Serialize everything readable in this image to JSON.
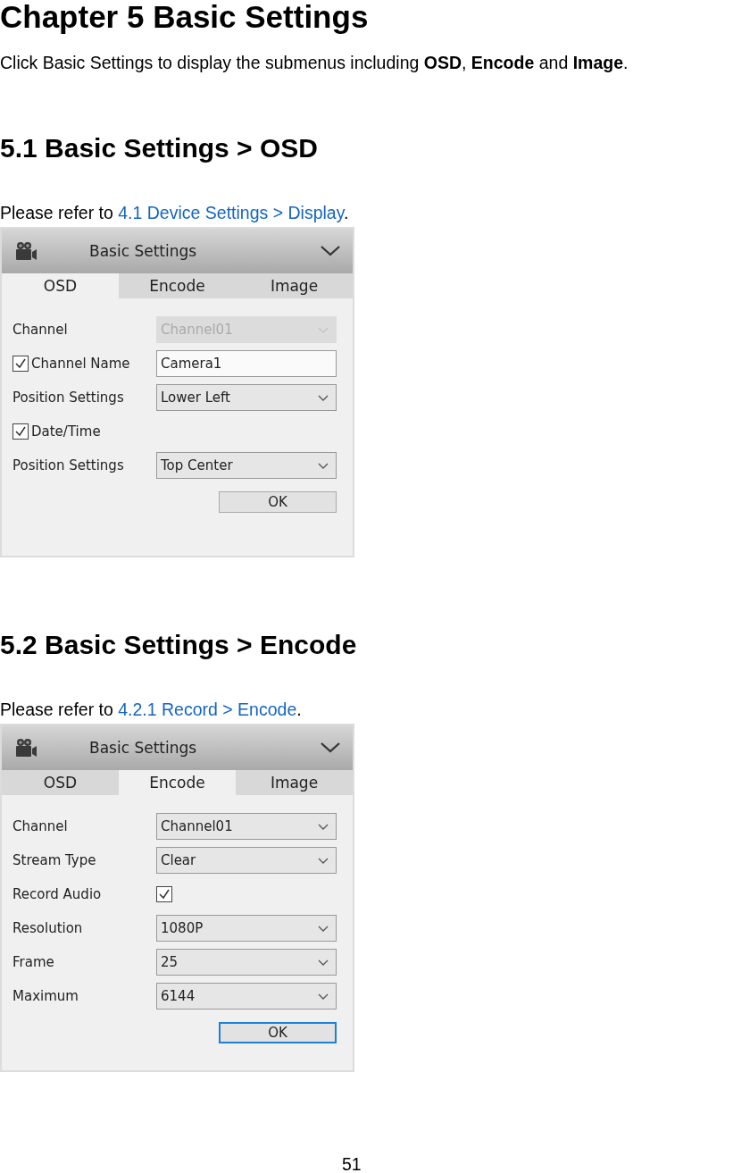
{
  "title": "Chapter 5 Basic Settings",
  "intro": "Click Basic Settings to display the submenus including **OSD**, **Encode** and **Image**.",
  "sections": [
    {
      "heading": "5.1 Basic Settings > OSD",
      "ref_prefix": "Please refer to ",
      "ref_link": "4.1 Device Settings > Display",
      "ref_suffix": ".",
      "panel": {
        "title": "Basic Settings",
        "tabs": [
          {
            "label": "OSD",
            "selected": true
          },
          {
            "label": "Encode",
            "selected": false
          },
          {
            "label": "Image",
            "selected": false
          }
        ],
        "rows": [
          {
            "kind": "select",
            "label": "Channel",
            "value": "Channel01",
            "disabled": true
          },
          {
            "kind": "text",
            "label": "Channel Name",
            "checked": true,
            "value": "Camera1"
          },
          {
            "kind": "select",
            "label": "Position Settings",
            "value": "Lower Left",
            "disabled": false
          },
          {
            "kind": "check",
            "label": "Date/Time",
            "checked": true
          },
          {
            "kind": "select",
            "label": "Position Settings",
            "value": "Top Center",
            "disabled": false
          }
        ],
        "ok": {
          "label": "OK",
          "focused": false
        }
      }
    },
    {
      "heading": "5.2 Basic Settings > Encode",
      "ref_prefix": "Please refer to ",
      "ref_link": "4.2.1 Record > Encode",
      "ref_suffix": ".",
      "panel": {
        "title": "Basic Settings",
        "tabs": [
          {
            "label": "OSD",
            "selected": false
          },
          {
            "label": "Encode",
            "selected": true
          },
          {
            "label": "Image",
            "selected": false
          }
        ],
        "rows": [
          {
            "kind": "select",
            "label": "Channel",
            "value": "Channel01",
            "disabled": false
          },
          {
            "kind": "select",
            "label": "Stream Type",
            "value": "Clear",
            "disabled": false
          },
          {
            "kind": "check_right",
            "label": "Record Audio",
            "checked": true
          },
          {
            "kind": "select",
            "label": "Resolution",
            "value": "1080P",
            "disabled": false
          },
          {
            "kind": "select",
            "label": "Frame",
            "value": "25",
            "disabled": false
          },
          {
            "kind": "select",
            "label": "Maximum",
            "value": "6144",
            "disabled": false
          }
        ],
        "ok": {
          "label": "OK",
          "focused": true
        }
      }
    }
  ],
  "page_number": "51"
}
